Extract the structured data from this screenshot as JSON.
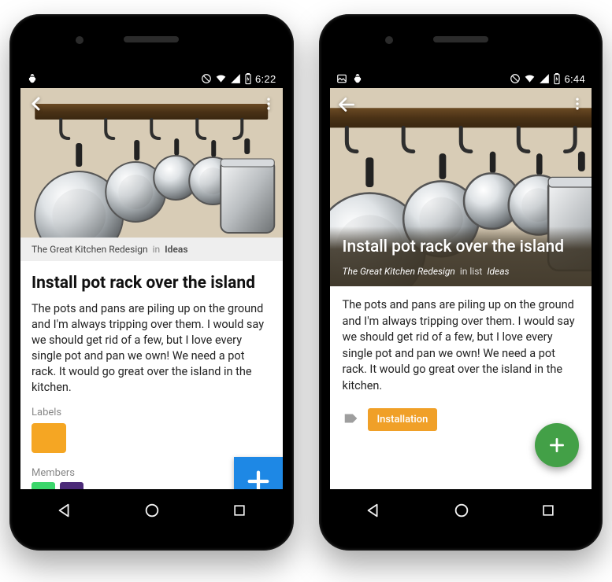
{
  "left": {
    "status": {
      "time": "6:22"
    },
    "board": "The Great Kitchen Redesign",
    "in_word": "in",
    "list": "Ideas",
    "title": "Install pot rack over the island",
    "description": "The pots and pans are piling up on the ground and I'm always tripping over them. I would say we should get rid of a few, but I love every single pot and pan we own! We need a pot rack. It would go great over the island in the kitchen.",
    "labels_heading": "Labels",
    "label_color": "#F5A623",
    "members_heading": "Members",
    "fab_color": "#1E88E5"
  },
  "right": {
    "status": {
      "time": "6:44"
    },
    "title": "Install pot rack over the island",
    "board": "The Great Kitchen Redesign",
    "in_words": "in list",
    "list": "Ideas",
    "description": "The pots and pans are piling up on the ground and I'm always tripping over them. I would say we should get rid of a few, but I love every single pot and pan we own! We need a pot rack. It would go great over the island in the kitchen.",
    "label_text": "Installation",
    "label_color": "#F0A028",
    "fab_color": "#43A047"
  }
}
